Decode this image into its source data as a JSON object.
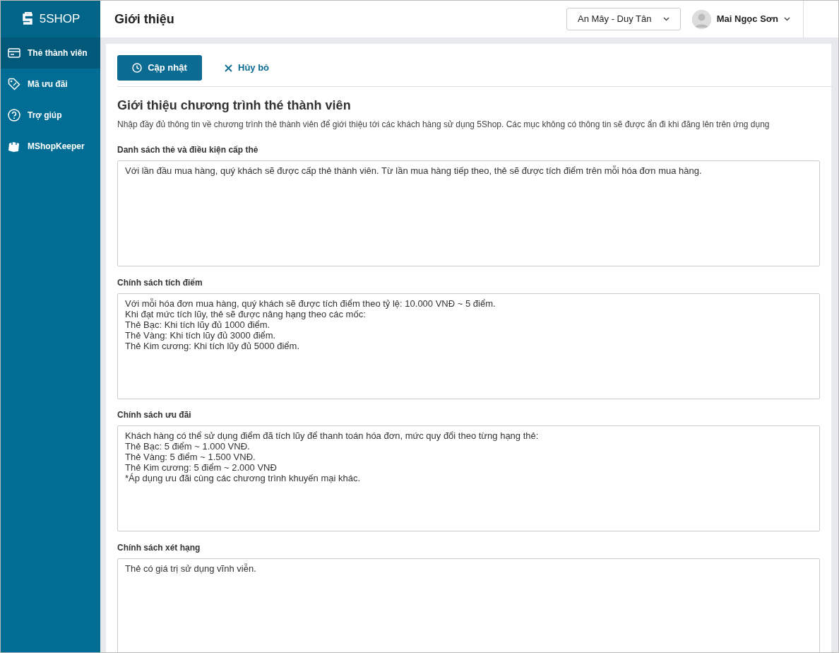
{
  "sidebar": {
    "logo": "5SHOP",
    "items": [
      {
        "label": "Thẻ thành viên",
        "selected": true
      },
      {
        "label": "Mã ưu đãi",
        "selected": false
      },
      {
        "label": "Trợ giúp",
        "selected": false
      },
      {
        "label": "MShopKeeper",
        "selected": false
      }
    ]
  },
  "header": {
    "title": "Giới thiệu",
    "store_select": {
      "value": "An Mây - Duy Tân"
    },
    "user": {
      "name": "Mai Ngọc Sơn"
    }
  },
  "toolbar": {
    "buttons": [
      {
        "label": "Cập nhật",
        "kind": "primary"
      },
      {
        "label": "Hủy bỏ",
        "kind": "cancel"
      }
    ]
  },
  "form": {
    "title": "Giới thiệu chương trình thé thành viên",
    "description": "Nhập đầy đủ thông tin về chương trình thẻ thành viên để giới thiệu tới các khách hàng sử dụng 5Shop. Các mục không có thông tin sẽ được ẩn đi khi đăng lên trên ứng dụng",
    "fields": [
      {
        "label": "Danh sách thẻ và điều kiện cấp thẻ",
        "value": "Với lần đầu mua hàng, quý khách sẽ được cấp thẻ thành viên. Từ lần mua hàng tiếp theo, thẻ sẽ được tích điểm trên mỗi hóa đơn mua hàng."
      },
      {
        "label": "Chính sách tích điểm",
        "value": "Với mỗi hóa đơn mua hàng, quý khách sẽ được tích điểm theo tỷ lệ: 10.000 VNĐ ~ 5 điểm.\nKhi đạt mức tích lũy, thẻ sẽ được nâng hạng theo các mốc:\nThẻ Bạc: Khi tích lũy đủ 1000 điểm.\nThẻ Vàng: Khi tích lũy đủ 3000 điểm.\nThẻ Kim cương: Khi tích lũy đủ 5000 điểm."
      },
      {
        "label": "Chính sách ưu đãi",
        "value": "Khách hàng có thể sử dụng điểm đã tích lũy để thanh toán hóa đơn, mức quy đổi theo từng hạng thẻ:\nThẻ Bạc: 5 điểm ~ 1.000 VNĐ.\nThẻ Vàng: 5 điểm ~ 1.500 VNĐ.\nThẻ Kim cương: 5 điểm ~ 2.000 VNĐ\n*Áp dụng ưu đãi cùng các chương trình khuyến mại khác."
      },
      {
        "label": "Chính sách xét hạng",
        "value": "Thẻ có giá trị sử dụng vĩnh viễn."
      }
    ]
  }
}
